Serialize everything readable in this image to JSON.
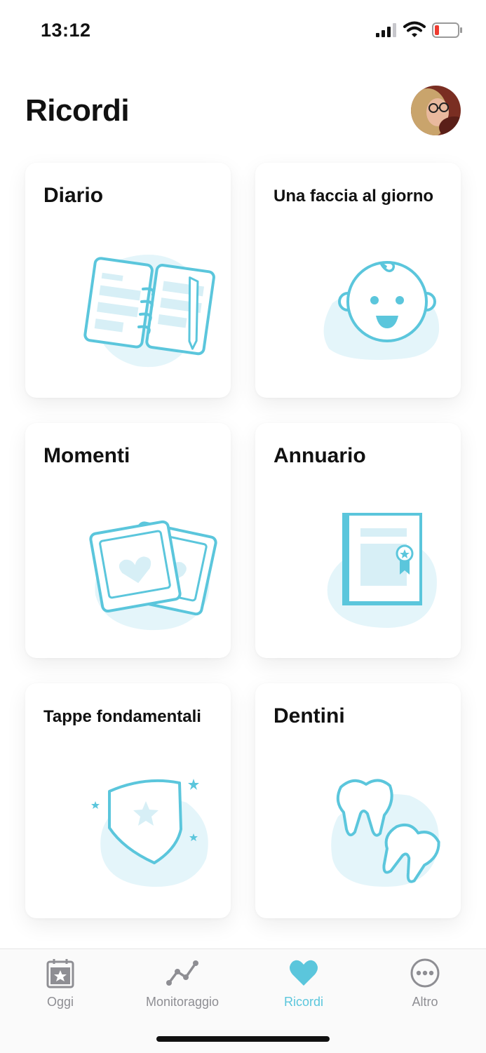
{
  "status_bar": {
    "time": "13:12"
  },
  "header": {
    "title": "Ricordi"
  },
  "cards": [
    {
      "label": "Diario"
    },
    {
      "label": "Una faccia al giorno"
    },
    {
      "label": "Momenti"
    },
    {
      "label": "Annuario"
    },
    {
      "label": "Tappe fondamentali"
    },
    {
      "label": "Dentini"
    }
  ],
  "tabs": [
    {
      "label": "Oggi",
      "icon": "calendar-star-icon"
    },
    {
      "label": "Monitoraggio",
      "icon": "chart-line-icon"
    },
    {
      "label": "Ricordi",
      "icon": "heart-icon"
    },
    {
      "label": "Altro",
      "icon": "more-dots-icon"
    }
  ],
  "colors": {
    "accent": "#5bc6dc",
    "accent_light": "#e4f5fa",
    "inactive": "#8e8e93"
  }
}
